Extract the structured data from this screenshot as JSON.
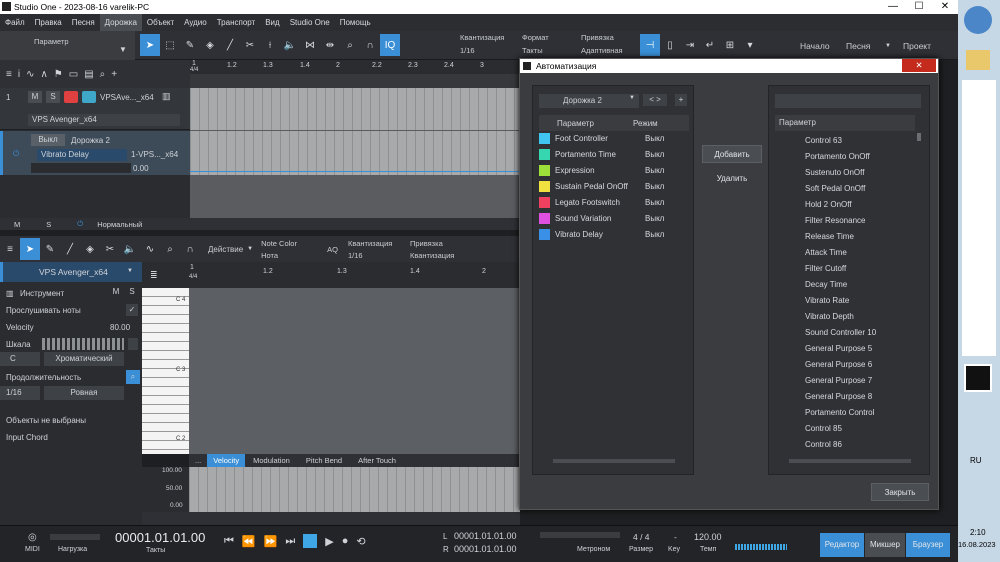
{
  "window": {
    "title": "Studio One - 2023-08-16 varelik-PC",
    "controls": [
      "—",
      "☐",
      "✕"
    ]
  },
  "menu": [
    "Файл",
    "Правка",
    "Песня",
    "Дорожка",
    "Объект",
    "Аудио",
    "Транспорт",
    "Вид",
    "Studio One",
    "Помощь"
  ],
  "toolbar": {
    "param_label": "Параметр",
    "quant_label": "Квантизация",
    "quant_value": "1/16",
    "format_label": "Формат",
    "format_value": "Такты",
    "snap_label": "Привязка",
    "snap_value": "Адаптивная",
    "start": "Начало",
    "song": "Песня",
    "project": "Проект",
    "iq": "IQ"
  },
  "ruler": [
    "1.2",
    "1.3",
    "1.4",
    "2",
    "2.2",
    "2.3",
    "2.4",
    "3"
  ],
  "ruler_first": "1",
  "ruler_sig": "4/4",
  "tracks": [
    {
      "num": "1",
      "name": "VPSAve..._x64",
      "instrument": "VPS Avenger_x64"
    },
    {
      "num": "2",
      "name": "Дорожка 2",
      "off": "Выкл",
      "param": "Vibrato Delay",
      "inst": "1-VPS..._x64",
      "value": "0.00"
    }
  ],
  "trackfoot": {
    "m": "M",
    "s": "S",
    "mode": "Нормальный"
  },
  "editor": {
    "action": "Действие",
    "note_color_label": "Note Color",
    "note_color_value": "Нота",
    "aq": "AQ",
    "quant_label": "Квантизация",
    "quant_value": "1/16",
    "snap_label": "Привязка",
    "snap_value": "Квантизация",
    "ruler": [
      "1.2",
      "1.3",
      "1.4",
      "2"
    ]
  },
  "inspector": {
    "instrument": "VPS Avenger_x64",
    "inst_label": "Инструмент",
    "m": "M",
    "s": "S",
    "listen": "Прослушивать ноты",
    "velocity_label": "Velocity",
    "velocity_value": "80.00",
    "scale_label": "Шкала",
    "key": "C",
    "scale_type": "Хроматический",
    "duration_label": "Продолжительность",
    "dur_value": "1/16",
    "dur_mode": "Ровная",
    "no_objects": "Объекты не выбраны",
    "input_chord": "Input Chord"
  },
  "piano_labels": [
    "C 4",
    "C 3",
    "C 2"
  ],
  "lanes": {
    "tabs": [
      "...",
      "Velocity",
      "Modulation",
      "Pitch Bend",
      "After Touch"
    ],
    "scale": [
      "100.00",
      "50.00",
      "0.00"
    ]
  },
  "automation": {
    "title": "Автоматизация",
    "track": "Дорожка 2",
    "col_param": "Параметр",
    "col_mode": "Режим",
    "items": [
      {
        "name": "Foot Controller",
        "mode": "Выкл",
        "color": "#3fc5f0"
      },
      {
        "name": "Portamento Time",
        "mode": "Выкл",
        "color": "#36d6b0"
      },
      {
        "name": "Expression",
        "mode": "Выкл",
        "color": "#9ee03a"
      },
      {
        "name": "Sustain Pedal OnOff",
        "mode": "Выкл",
        "color": "#f0e040"
      },
      {
        "name": "Legato Footswitch",
        "mode": "Выкл",
        "color": "#f04060"
      },
      {
        "name": "Sound Variation",
        "mode": "Выкл",
        "color": "#e050e0"
      },
      {
        "name": "Vibrato Delay",
        "mode": "Выкл",
        "color": "#3a8fe6"
      }
    ],
    "add": "Добавить",
    "remove": "Удалить",
    "right_header": "Параметр",
    "right_items": [
      "Control 63",
      "Portamento OnOff",
      "Sustenuto OnOff",
      "Soft Pedal OnOff",
      "Hold 2 OnOff",
      "Filter Resonance",
      "Release Time",
      "Attack Time",
      "Filter Cutoff",
      "Decay Time",
      "Vibrato Rate",
      "Vibrato Depth",
      "Sound Controller 10",
      "General Purpose 5",
      "General Purpose 6",
      "General Purpose 7",
      "General Purpose 8",
      "Portamento Control",
      "Control 85",
      "Control 86"
    ],
    "close": "Закрыть"
  },
  "transport": {
    "midi": "MIDI",
    "load": "Нагрузка",
    "position": "00001.01.01.00",
    "pos_unit": "Такты",
    "l": "00001.01.01.00",
    "r": "00001.01.01.00",
    "metronome": "Метроном",
    "sig": "4 / 4",
    "sig_label": "Размер",
    "key": "-",
    "key_label": "Key",
    "tempo": "120.00",
    "tempo_label": "Темп",
    "editor": "Редактор",
    "mixer": "Микшер",
    "browser": "Браузер"
  },
  "taskbar": {
    "lang": "RU",
    "time": "2:10",
    "date": "16.08.2023"
  }
}
